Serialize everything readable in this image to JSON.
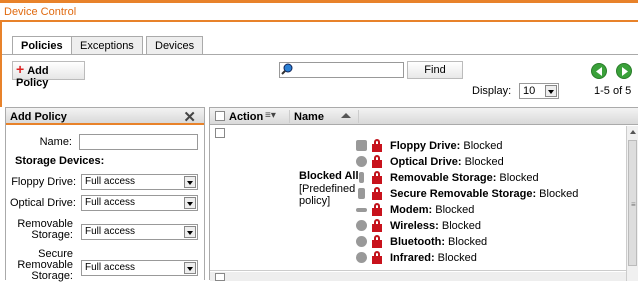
{
  "titlebar": {
    "title": "Device Control"
  },
  "tabs": [
    {
      "label": "Policies",
      "active": true
    },
    {
      "label": "Exceptions",
      "active": false
    },
    {
      "label": "Devices",
      "active": false
    }
  ],
  "toolbar": {
    "add_policy_label": "Add Policy",
    "search": {
      "value": "",
      "placeholder": ""
    },
    "find_label": "Find",
    "display_label": "Display:",
    "display_value": "10",
    "paging_text": "1-5 of 5"
  },
  "add_policy_panel": {
    "title": "Add Policy",
    "name_label": "Name:",
    "name_value": "",
    "storage_heading": "Storage Devices:",
    "fields": [
      {
        "label": "Floppy Drive:",
        "value": "Full access"
      },
      {
        "label": "Optical Drive:",
        "value": "Full access"
      },
      {
        "label": "Removable Storage:",
        "value": "Full access"
      },
      {
        "label": "Secure Removable Storage:",
        "value": "Full access"
      }
    ]
  },
  "grid": {
    "columns": {
      "action": "Action",
      "name": "Name"
    },
    "rows": [
      {
        "name": "Blocked All",
        "subtitle": "[Predefined policy]",
        "devices": [
          {
            "name": "Floppy Drive:",
            "status": " Blocked",
            "icon": "floppy-icon"
          },
          {
            "name": "Optical Drive:",
            "status": " Blocked",
            "icon": "optical-icon"
          },
          {
            "name": "Removable Storage:",
            "status": " Blocked",
            "icon": "usb-icon"
          },
          {
            "name": "Secure Removable Storage:",
            "status": " Blocked",
            "icon": "secure-usb-icon"
          },
          {
            "name": "Modem:",
            "status": " Blocked",
            "icon": "modem-icon"
          },
          {
            "name": "Wireless:",
            "status": " Blocked",
            "icon": "wireless-icon"
          },
          {
            "name": "Bluetooth:",
            "status": " Blocked",
            "icon": "bluetooth-icon"
          },
          {
            "name": "Infrared:",
            "status": " Blocked",
            "icon": "infrared-icon"
          }
        ]
      }
    ]
  },
  "colors": {
    "accent": "#e8822a",
    "lock": "#c8121c",
    "nav": "#3aa13a"
  }
}
